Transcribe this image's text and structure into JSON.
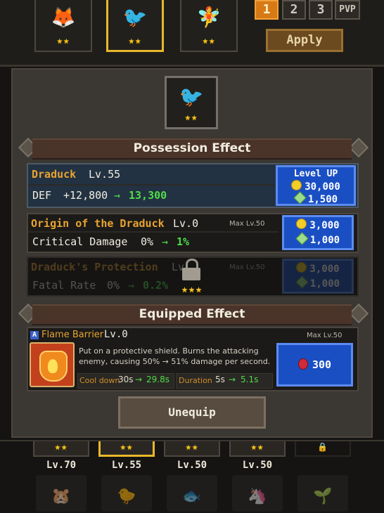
{
  "top_pets": [
    {
      "name": "fox-pet",
      "stars": "★★",
      "art": "🦊"
    },
    {
      "name": "draduck-pet",
      "stars": "★★",
      "art": "🐦"
    },
    {
      "name": "fairy-pet",
      "stars": "★★",
      "art": "🧚"
    }
  ],
  "team_tabs": [
    "1",
    "2",
    "3",
    "PVP"
  ],
  "apply_label": "Apply",
  "portrait": {
    "stars": "★★",
    "art": "🐦"
  },
  "possession": {
    "title": "Possession Effect",
    "main": {
      "name": "Draduck",
      "level": "Lv.55",
      "stat_label": "DEF",
      "stat_from": "+12,800",
      "stat_arrow": "→",
      "stat_to": "13,300",
      "levelup_label": "Level UP",
      "coin_cost": "30,000",
      "gem_cost": "1,500"
    },
    "origin": {
      "name": "Origin of the Draduck",
      "level": "Lv.0",
      "max": "Max Lv.50",
      "stat_label": "Critical Damage",
      "stat_from": "0%",
      "stat_arrow": "→",
      "stat_to": "1%",
      "coin_cost": "3,000",
      "gem_cost": "1,000"
    },
    "protection": {
      "name": "Draduck's Protection",
      "level": "Lv",
      "max": "Max Lv.50",
      "stat_label": "Fatal Rate",
      "stat_from": "0%",
      "stat_arrow": "→",
      "stat_to": "0.2%",
      "coin_cost": "3,000",
      "gem_cost": "1,000",
      "lock_stars": "★★★"
    }
  },
  "equipped": {
    "title": "Equipped Effect",
    "badge": "A",
    "skill_name": "Flame Barrier",
    "level": "Lv.0",
    "max": "Max Lv.50",
    "description": "Put on a protective shield. Burns the attacking enemy, causing 50% → 51% damage per second.",
    "cooldown_label": "Cool down",
    "cooldown_from": "30s",
    "cooldown_arrow": "→",
    "cooldown_to": "29.8s",
    "duration_label": "Duration",
    "duration_from": "5s",
    "duration_arrow": "→",
    "duration_to": "5.1s",
    "cost": "300",
    "unequip_label": "Unequip"
  },
  "roster": [
    {
      "stars": "★★",
      "level": "Lv.70",
      "art": "🐹"
    },
    {
      "stars": "★★",
      "level": "Lv.55",
      "art": "🐤"
    },
    {
      "stars": "★★",
      "level": "Lv.50",
      "art": "🐟"
    },
    {
      "stars": "★★",
      "level": "Lv.50",
      "art": "🦄"
    },
    {
      "stars": "🔒",
      "level": "",
      "art": "🌱"
    }
  ],
  "colors": {
    "accent_gold": "#e9b82a",
    "button_blue": "#1a4fc4",
    "bonus_green": "#4fdd49",
    "title_orange": "#e7a330"
  }
}
